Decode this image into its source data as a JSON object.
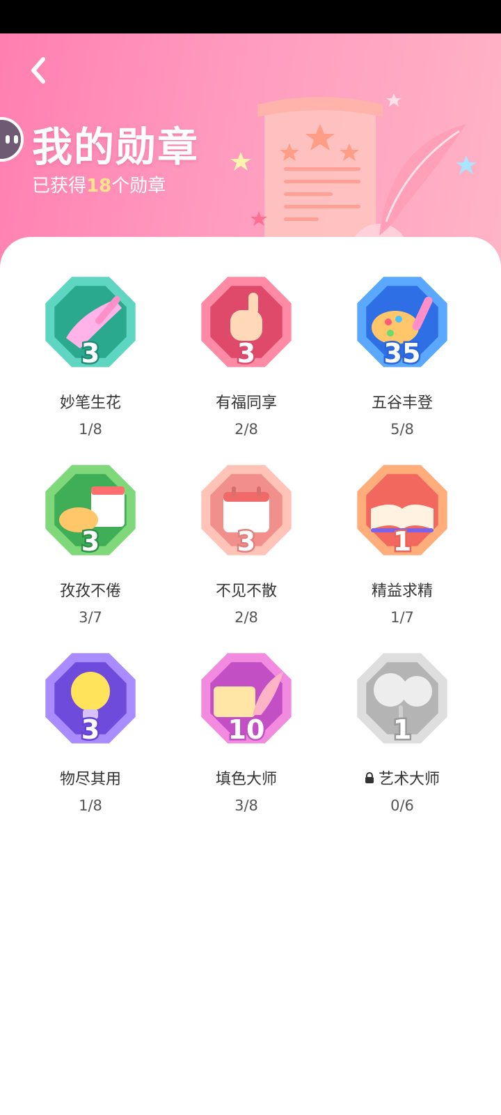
{
  "header": {
    "title": "我的勋章",
    "subtitle_prefix": "已获得",
    "subtitle_count": "18",
    "subtitle_suffix": "个勋章"
  },
  "colors": {
    "header_start": "#ff7fb0",
    "header_end": "#ffb4c6",
    "count_highlight": "#ffe38a"
  },
  "badges": [
    {
      "name": "妙笔生花",
      "level": "3",
      "progress": "1/8",
      "theme": "teal",
      "icon": "paintbrush-icon",
      "locked": false
    },
    {
      "name": "有福同享",
      "level": "3",
      "progress": "2/8",
      "theme": "rose",
      "icon": "thumbs-up-icon",
      "locked": false
    },
    {
      "name": "五谷丰登",
      "level": "35",
      "progress": "5/8",
      "theme": "blue",
      "icon": "palette-icon",
      "locked": false
    },
    {
      "name": "孜孜不倦",
      "level": "3",
      "progress": "3/7",
      "theme": "green",
      "icon": "calendar-palette-icon",
      "locked": false
    },
    {
      "name": "不见不散",
      "level": "3",
      "progress": "2/8",
      "theme": "peach",
      "icon": "calendar-icon",
      "locked": false
    },
    {
      "name": "精益求精",
      "level": "1",
      "progress": "1/7",
      "theme": "orange",
      "icon": "book-icon",
      "locked": false
    },
    {
      "name": "物尽其用",
      "level": "3",
      "progress": "1/8",
      "theme": "purple",
      "icon": "lightbulb-icon",
      "locked": false
    },
    {
      "name": "填色大师",
      "level": "10",
      "progress": "3/8",
      "theme": "magenta",
      "icon": "scroll-quill-icon",
      "locked": false
    },
    {
      "name": "艺术大师",
      "level": "1",
      "progress": "0/6",
      "theme": "gray",
      "icon": "flower-icon",
      "locked": true
    }
  ]
}
